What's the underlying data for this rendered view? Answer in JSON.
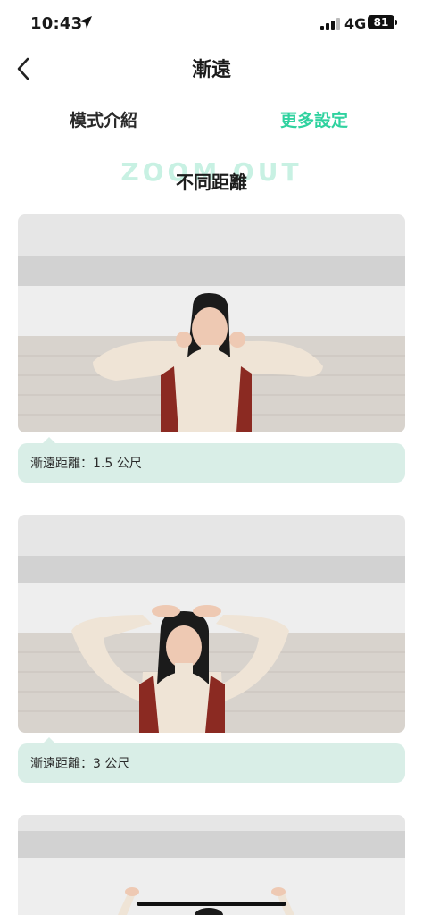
{
  "status_bar": {
    "time": "10:43",
    "network": "4G",
    "battery": "81"
  },
  "nav": {
    "title": "漸遠"
  },
  "tabs": [
    {
      "label": "模式介紹",
      "active": false
    },
    {
      "label": "更多設定",
      "active": true
    }
  ],
  "section": {
    "ghost_label": "ZOOM OUT",
    "title": "不同距離"
  },
  "cards": [
    {
      "caption": "漸遠距離：1.5 公尺"
    },
    {
      "caption": "漸遠距離：3 公尺"
    }
  ],
  "colors": {
    "accent": "#2fd29f",
    "caption_bg": "#d9eee7"
  }
}
